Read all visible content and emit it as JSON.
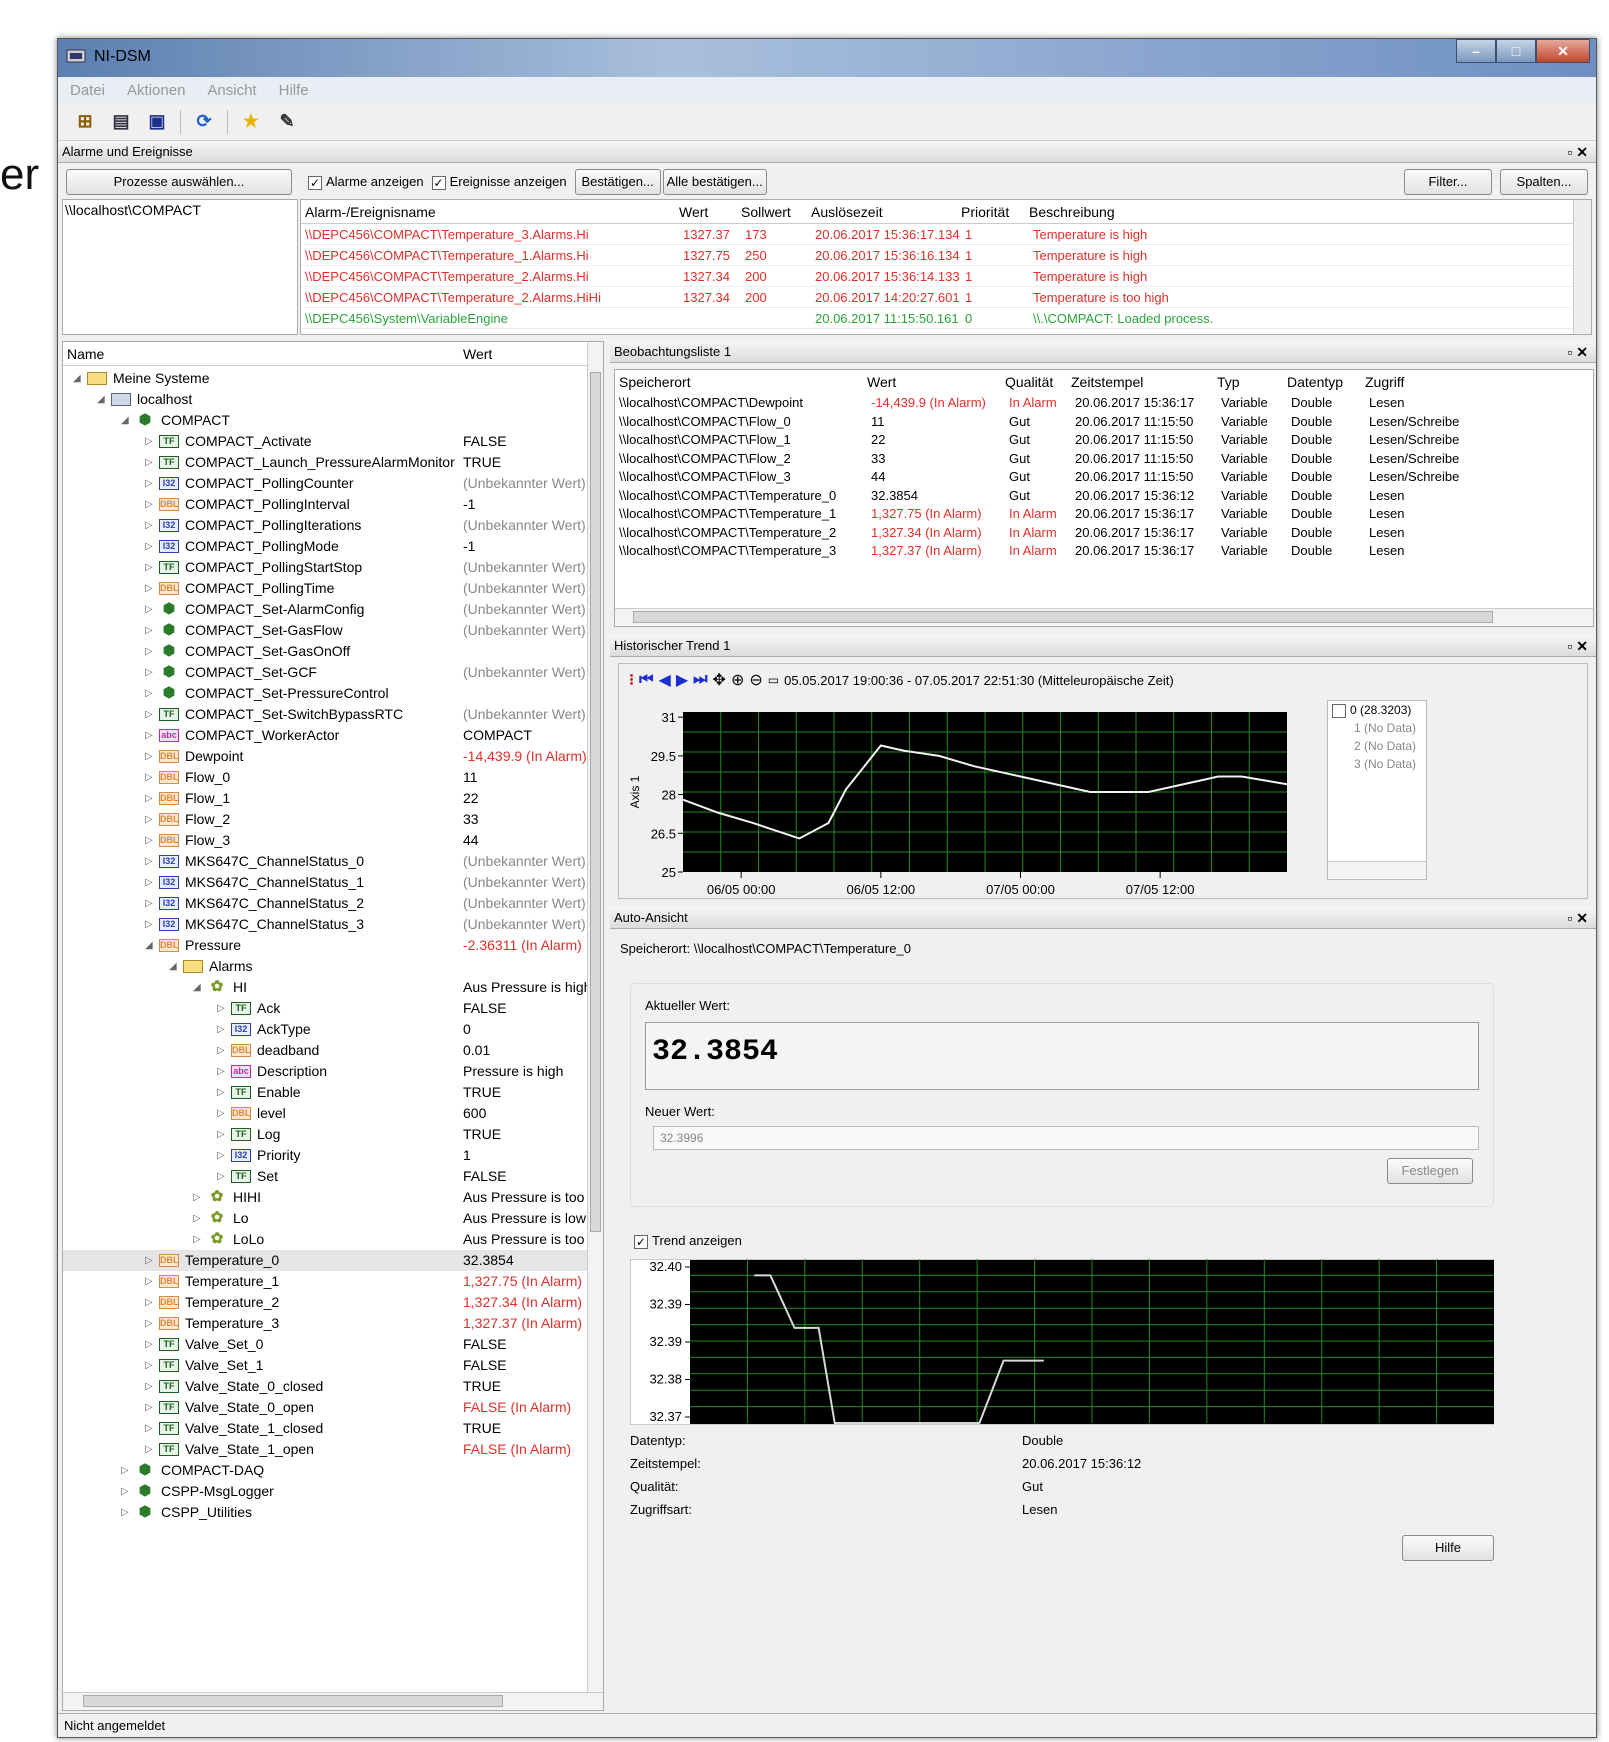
{
  "bg_text": "er",
  "window": {
    "title": "NI-DSM"
  },
  "menu": [
    "Datei",
    "Aktionen",
    "Ansicht",
    "Hilfe"
  ],
  "toolbar_icons": [
    "new-system-icon",
    "properties-icon",
    "save-icon",
    "refresh-icon",
    "star-icon",
    "script-icon"
  ],
  "alarms": {
    "panel_title": "Alarme und Ereignisse",
    "select_processes": "Prozesse auswählen...",
    "show_alarms": "Alarme anzeigen",
    "show_events": "Ereignisse anzeigen",
    "acknowledge": "Bestätigen...",
    "acknowledge_all": "Alle bestätigen...",
    "filter": "Filter...",
    "columns": "Spalten...",
    "process_item": "\\\\localhost\\COMPACT",
    "headers": [
      "Alarm-/Ereignisname",
      "Wert",
      "Sollwert",
      "Auslösezeit",
      "Priorität",
      "Beschreibung"
    ],
    "rows": [
      {
        "name": "\\\\DEPC456\\COMPACT\\Temperature_3.Alarms.Hi",
        "wert": "1327.37",
        "soll": "173",
        "zeit": "20.06.2017 15:36:17.134",
        "prio": "1",
        "desc": "Temperature is high",
        "color": "red"
      },
      {
        "name": "\\\\DEPC456\\COMPACT\\Temperature_1.Alarms.Hi",
        "wert": "1327.75",
        "soll": "250",
        "zeit": "20.06.2017 15:36:16.134",
        "prio": "1",
        "desc": "Temperature is high",
        "color": "red"
      },
      {
        "name": "\\\\DEPC456\\COMPACT\\Temperature_2.Alarms.Hi",
        "wert": "1327.34",
        "soll": "200",
        "zeit": "20.06.2017 15:36:14.133",
        "prio": "1",
        "desc": "Temperature is high",
        "color": "red"
      },
      {
        "name": "\\\\DEPC456\\COMPACT\\Temperature_2.Alarms.HiHi",
        "wert": "1327.34",
        "soll": "200",
        "zeit": "20.06.2017 14:20:27.601",
        "prio": "1",
        "desc": "Temperature is too high",
        "color": "red"
      },
      {
        "name": "\\\\DEPC456\\System\\VariableEngine",
        "wert": "",
        "soll": "",
        "zeit": "20.06.2017 11:15:50.161",
        "prio": "0",
        "desc": "\\\\.\\COMPACT: Loaded process.",
        "color": "green"
      }
    ]
  },
  "tree": {
    "headers": [
      "Name",
      "Wert"
    ],
    "rows": [
      {
        "d": 0,
        "t": "open",
        "i": "fold",
        "n": "Meine Systeme",
        "v": "",
        "c": ""
      },
      {
        "d": 1,
        "t": "open",
        "i": "pc",
        "n": "localhost",
        "v": "",
        "c": ""
      },
      {
        "d": 2,
        "t": "open",
        "i": "cls",
        "n": "COMPACT",
        "v": "",
        "c": ""
      },
      {
        "d": 3,
        "t": "closed",
        "i": "tf",
        "n": "COMPACT_Activate",
        "v": "FALSE",
        "c": ""
      },
      {
        "d": 3,
        "t": "closed",
        "i": "tf",
        "n": "COMPACT_Launch_PressureAlarmMonitor",
        "v": "TRUE",
        "c": ""
      },
      {
        "d": 3,
        "t": "closed",
        "i": "i32",
        "n": "COMPACT_PollingCounter",
        "v": "(Unbekannter Wert)",
        "c": "gray"
      },
      {
        "d": 3,
        "t": "closed",
        "i": "dbl",
        "n": "COMPACT_PollingInterval",
        "v": "-1",
        "c": ""
      },
      {
        "d": 3,
        "t": "closed",
        "i": "i32",
        "n": "COMPACT_PollingIterations",
        "v": "(Unbekannter Wert)",
        "c": "gray"
      },
      {
        "d": 3,
        "t": "closed",
        "i": "i32",
        "n": "COMPACT_PollingMode",
        "v": "-1",
        "c": ""
      },
      {
        "d": 3,
        "t": "closed",
        "i": "tf",
        "n": "COMPACT_PollingStartStop",
        "v": "(Unbekannter Wert)",
        "c": "gray"
      },
      {
        "d": 3,
        "t": "closed",
        "i": "dbl",
        "n": "COMPACT_PollingTime",
        "v": "(Unbekannter Wert)",
        "c": "gray"
      },
      {
        "d": 3,
        "t": "closed",
        "i": "cls",
        "n": "COMPACT_Set-AlarmConfig",
        "v": "(Unbekannter Wert)",
        "c": "gray"
      },
      {
        "d": 3,
        "t": "closed",
        "i": "cls",
        "n": "COMPACT_Set-GasFlow",
        "v": "(Unbekannter Wert)",
        "c": "gray"
      },
      {
        "d": 3,
        "t": "closed",
        "i": "cls",
        "n": "COMPACT_Set-GasOnOff",
        "v": "",
        "c": ""
      },
      {
        "d": 3,
        "t": "closed",
        "i": "cls",
        "n": "COMPACT_Set-GCF",
        "v": "(Unbekannter Wert)",
        "c": "gray"
      },
      {
        "d": 3,
        "t": "closed",
        "i": "cls",
        "n": "COMPACT_Set-PressureControl",
        "v": "",
        "c": ""
      },
      {
        "d": 3,
        "t": "closed",
        "i": "tf",
        "n": "COMPACT_Set-SwitchBypassRTC",
        "v": "(Unbekannter Wert)",
        "c": "gray"
      },
      {
        "d": 3,
        "t": "closed",
        "i": "str",
        "n": "COMPACT_WorkerActor",
        "v": "COMPACT",
        "c": ""
      },
      {
        "d": 3,
        "t": "closed",
        "i": "dbl",
        "n": "Dewpoint",
        "v": "-14,439.9 (In Alarm)",
        "c": "red"
      },
      {
        "d": 3,
        "t": "closed",
        "i": "dbl",
        "n": "Flow_0",
        "v": "11",
        "c": ""
      },
      {
        "d": 3,
        "t": "closed",
        "i": "dbl",
        "n": "Flow_1",
        "v": "22",
        "c": ""
      },
      {
        "d": 3,
        "t": "closed",
        "i": "dbl",
        "n": "Flow_2",
        "v": "33",
        "c": ""
      },
      {
        "d": 3,
        "t": "closed",
        "i": "dbl",
        "n": "Flow_3",
        "v": "44",
        "c": ""
      },
      {
        "d": 3,
        "t": "closed",
        "i": "i32",
        "n": "MKS647C_ChannelStatus_0",
        "v": "(Unbekannter Wert)",
        "c": "gray"
      },
      {
        "d": 3,
        "t": "closed",
        "i": "i32",
        "n": "MKS647C_ChannelStatus_1",
        "v": "(Unbekannter Wert)",
        "c": "gray"
      },
      {
        "d": 3,
        "t": "closed",
        "i": "i32",
        "n": "MKS647C_ChannelStatus_2",
        "v": "(Unbekannter Wert)",
        "c": "gray"
      },
      {
        "d": 3,
        "t": "closed",
        "i": "i32",
        "n": "MKS647C_ChannelStatus_3",
        "v": "(Unbekannter Wert)",
        "c": "gray"
      },
      {
        "d": 3,
        "t": "open",
        "i": "dbl",
        "n": "Pressure",
        "v": "-2.36311 (In Alarm)",
        "c": "red"
      },
      {
        "d": 4,
        "t": "open",
        "i": "fold",
        "n": "Alarms",
        "v": "",
        "c": ""
      },
      {
        "d": 5,
        "t": "open",
        "i": "gear",
        "n": "HI",
        "v": "Aus Pressure is high",
        "c": ""
      },
      {
        "d": 6,
        "t": "closed",
        "i": "tf",
        "n": "Ack",
        "v": "FALSE",
        "c": ""
      },
      {
        "d": 6,
        "t": "closed",
        "i": "i32",
        "n": "AckType",
        "v": "0",
        "c": ""
      },
      {
        "d": 6,
        "t": "closed",
        "i": "dbl",
        "n": "deadband",
        "v": "0.01",
        "c": ""
      },
      {
        "d": 6,
        "t": "closed",
        "i": "str",
        "n": "Description",
        "v": "Pressure is high",
        "c": ""
      },
      {
        "d": 6,
        "t": "closed",
        "i": "tf",
        "n": "Enable",
        "v": "TRUE",
        "c": ""
      },
      {
        "d": 6,
        "t": "closed",
        "i": "dbl",
        "n": "level",
        "v": "600",
        "c": ""
      },
      {
        "d": 6,
        "t": "closed",
        "i": "tf",
        "n": "Log",
        "v": "TRUE",
        "c": ""
      },
      {
        "d": 6,
        "t": "closed",
        "i": "i32",
        "n": "Priority",
        "v": "1",
        "c": ""
      },
      {
        "d": 6,
        "t": "closed",
        "i": "tf",
        "n": "Set",
        "v": "FALSE",
        "c": ""
      },
      {
        "d": 5,
        "t": "closed",
        "i": "gear",
        "n": "HIHI",
        "v": "Aus Pressure is too h",
        "c": ""
      },
      {
        "d": 5,
        "t": "closed",
        "i": "gear",
        "n": "Lo",
        "v": "Aus Pressure is low",
        "c": ""
      },
      {
        "d": 5,
        "t": "closed",
        "i": "gear",
        "n": "LoLo",
        "v": "Aus Pressure is too lo",
        "c": ""
      },
      {
        "d": 3,
        "t": "closed",
        "i": "dbl",
        "n": "Temperature_0",
        "v": "32.3854",
        "c": "",
        "sel": true
      },
      {
        "d": 3,
        "t": "closed",
        "i": "dbl",
        "n": "Temperature_1",
        "v": "1,327.75 (In Alarm)",
        "c": "red"
      },
      {
        "d": 3,
        "t": "closed",
        "i": "dbl",
        "n": "Temperature_2",
        "v": "1,327.34 (In Alarm)",
        "c": "red"
      },
      {
        "d": 3,
        "t": "closed",
        "i": "dbl",
        "n": "Temperature_3",
        "v": "1,327.37 (In Alarm)",
        "c": "red"
      },
      {
        "d": 3,
        "t": "closed",
        "i": "tf",
        "n": "Valve_Set_0",
        "v": "FALSE",
        "c": ""
      },
      {
        "d": 3,
        "t": "closed",
        "i": "tf",
        "n": "Valve_Set_1",
        "v": "FALSE",
        "c": ""
      },
      {
        "d": 3,
        "t": "closed",
        "i": "tf",
        "n": "Valve_State_0_closed",
        "v": "TRUE",
        "c": ""
      },
      {
        "d": 3,
        "t": "closed",
        "i": "tf",
        "n": "Valve_State_0_open",
        "v": "FALSE (In Alarm)",
        "c": "red"
      },
      {
        "d": 3,
        "t": "closed",
        "i": "tf",
        "n": "Valve_State_1_closed",
        "v": "TRUE",
        "c": ""
      },
      {
        "d": 3,
        "t": "closed",
        "i": "tf",
        "n": "Valve_State_1_open",
        "v": "FALSE (In Alarm)",
        "c": "red"
      },
      {
        "d": 2,
        "t": "closed",
        "i": "cls",
        "n": "COMPACT-DAQ",
        "v": "",
        "c": ""
      },
      {
        "d": 2,
        "t": "closed",
        "i": "cls",
        "n": "CSPP-MsgLogger",
        "v": "",
        "c": ""
      },
      {
        "d": 2,
        "t": "closed",
        "i": "cls",
        "n": "CSPP_Utilities",
        "v": "",
        "c": ""
      }
    ]
  },
  "watch": {
    "panel_title": "Beobachtungsliste 1",
    "headers": [
      "Speicherort",
      "Wert",
      "Qualität",
      "Zeitstempel",
      "Typ",
      "Datentyp",
      "Zugriff"
    ],
    "rows": [
      {
        "loc": "\\\\localhost\\COMPACT\\Dewpoint",
        "wert": "-14,439.9 (In Alarm)",
        "q": "In Alarm",
        "ts": "20.06.2017 15:36:17",
        "typ": "Variable",
        "dt": "Double",
        "z": "Lesen",
        "alarm": true
      },
      {
        "loc": "\\\\localhost\\COMPACT\\Flow_0",
        "wert": "11",
        "q": "Gut",
        "ts": "20.06.2017 11:15:50",
        "typ": "Variable",
        "dt": "Double",
        "z": "Lesen/Schreibe",
        "alarm": false
      },
      {
        "loc": "\\\\localhost\\COMPACT\\Flow_1",
        "wert": "22",
        "q": "Gut",
        "ts": "20.06.2017 11:15:50",
        "typ": "Variable",
        "dt": "Double",
        "z": "Lesen/Schreibe",
        "alarm": false
      },
      {
        "loc": "\\\\localhost\\COMPACT\\Flow_2",
        "wert": "33",
        "q": "Gut",
        "ts": "20.06.2017 11:15:50",
        "typ": "Variable",
        "dt": "Double",
        "z": "Lesen/Schreibe",
        "alarm": false
      },
      {
        "loc": "\\\\localhost\\COMPACT\\Flow_3",
        "wert": "44",
        "q": "Gut",
        "ts": "20.06.2017 11:15:50",
        "typ": "Variable",
        "dt": "Double",
        "z": "Lesen/Schreibe",
        "alarm": false
      },
      {
        "loc": "\\\\localhost\\COMPACT\\Temperature_0",
        "wert": "32.3854",
        "q": "Gut",
        "ts": "20.06.2017 15:36:12",
        "typ": "Variable",
        "dt": "Double",
        "z": "Lesen",
        "alarm": false
      },
      {
        "loc": "\\\\localhost\\COMPACT\\Temperature_1",
        "wert": "1,327.75 (In Alarm)",
        "q": "In Alarm",
        "ts": "20.06.2017 15:36:17",
        "typ": "Variable",
        "dt": "Double",
        "z": "Lesen",
        "alarm": true
      },
      {
        "loc": "\\\\localhost\\COMPACT\\Temperature_2",
        "wert": "1,327.34 (In Alarm)",
        "q": "In Alarm",
        "ts": "20.06.2017 15:36:17",
        "typ": "Variable",
        "dt": "Double",
        "z": "Lesen",
        "alarm": true
      },
      {
        "loc": "\\\\localhost\\COMPACT\\Temperature_3",
        "wert": "1,327.37 (In Alarm)",
        "q": "In Alarm",
        "ts": "20.06.2017 15:36:17",
        "typ": "Variable",
        "dt": "Double",
        "z": "Lesen",
        "alarm": true
      }
    ]
  },
  "trend": {
    "panel_title": "Historischer Trend 1",
    "time_range": "05.05.2017 19:00:36 - 07.05.2017 22:51:30 (Mitteleuropäische Zeit)",
    "legend": [
      {
        "label": "0 (28.3203)",
        "color": "#000"
      },
      {
        "label": "1 (No Data)",
        "color": "#888"
      },
      {
        "label": "2 (No Data)",
        "color": "#888"
      },
      {
        "label": "3 (No Data)",
        "color": "#888"
      }
    ],
    "chart_data": {
      "type": "line",
      "ylabel": "Axis 1",
      "yticks": [
        "31",
        "29.5",
        "28",
        "26.5",
        "25"
      ],
      "ylim": [
        25,
        31.2
      ],
      "xticks": [
        "06/05 00:00",
        "06/05 12:00",
        "07/05 00:00",
        "07/05 12:00"
      ],
      "xlim_hours": [
        -5,
        46.9
      ],
      "series": [
        {
          "x_hours": [
            -5,
            -2,
            1,
            5,
            7.5,
            9,
            12,
            14,
            17,
            20,
            24,
            30,
            35,
            38,
            41,
            43,
            46.9
          ],
          "values": [
            27.8,
            27.3,
            26.9,
            26.3,
            26.9,
            28.2,
            29.9,
            29.7,
            29.5,
            29.1,
            28.7,
            28.1,
            28.1,
            28.4,
            28.7,
            28.7,
            28.4
          ]
        }
      ]
    }
  },
  "auto": {
    "panel_title": "Auto-Ansicht",
    "location_label": "Speicherort: \\\\localhost\\COMPACT\\Temperature_0",
    "current_label": "Aktueller Wert:",
    "current_value": "32.3854",
    "new_label": "Neuer Wert:",
    "new_value": "32.3996",
    "set_button": "Festlegen",
    "trend_checkbox": "Trend anzeigen",
    "chart_data": {
      "type": "line",
      "yticks": [
        "32.40",
        "32.39",
        "32.39",
        "32.38",
        "32.37"
      ],
      "series": [
        {
          "x": [
            0.08,
            0.1,
            0.13,
            0.16,
            0.18,
            0.36,
            0.39,
            0.44
          ],
          "values": [
            0.9,
            0.9,
            0.58,
            0.58,
            0.0,
            0.0,
            0.38,
            0.38
          ]
        }
      ]
    },
    "props": [
      {
        "k": "Datentyp:",
        "v": "Double"
      },
      {
        "k": "Zeitstempel:",
        "v": "20.06.2017 15:36:12"
      },
      {
        "k": "Qualität:",
        "v": "Gut"
      },
      {
        "k": "Zugriffsart:",
        "v": "Lesen"
      }
    ],
    "help": "Hilfe"
  },
  "status": "Nicht angemeldet"
}
